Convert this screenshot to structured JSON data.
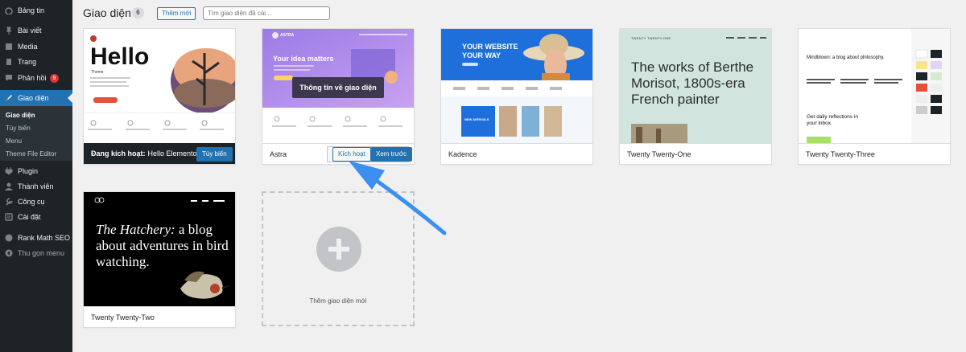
{
  "sidebar": {
    "items": [
      {
        "label": "Bảng tin",
        "icon": "dashboard-icon"
      },
      {
        "label": "Bài viết",
        "icon": "pin-icon"
      },
      {
        "label": "Media",
        "icon": "media-icon"
      },
      {
        "label": "Trang",
        "icon": "page-icon"
      },
      {
        "label": "Phản hồi",
        "icon": "comment-icon",
        "badge": "9"
      },
      {
        "label": "Giao diện",
        "icon": "brush-icon"
      },
      {
        "label": "Plugin",
        "icon": "plugin-icon"
      },
      {
        "label": "Thành viên",
        "icon": "users-icon"
      },
      {
        "label": "Công cụ",
        "icon": "wrench-icon"
      },
      {
        "label": "Cài đặt",
        "icon": "settings-icon"
      },
      {
        "label": "Rank Math SEO",
        "icon": "rankmath-icon"
      },
      {
        "label": "Thu gọn menu",
        "icon": "collapse-icon"
      }
    ],
    "submenu": [
      "Giao diện",
      "Tùy biến",
      "Menu",
      "Theme File Editor"
    ]
  },
  "header": {
    "title": "Giao diện",
    "count": "6",
    "add_new": "Thêm mới",
    "search_placeholder": "Tìm giao diện đã cài..."
  },
  "themes": {
    "hello": {
      "active_prefix": "Đang kích hoạt:",
      "name": "Hello Elementor",
      "customize": "Tùy biến",
      "shot_title": "Hello",
      "shot_sub": "Theme"
    },
    "astra": {
      "name": "Astra",
      "activate": "Kích hoạt",
      "preview": "Xem trước",
      "overlay": "Thông tin về giao diện",
      "shot_logo": "ASTRA",
      "shot_headline": "Your idea matters"
    },
    "kadence": {
      "name": "Kadence",
      "shot_headline_1": "YOUR WEBSITE",
      "shot_headline_2": "YOUR WAY",
      "shot_badge": "NEW ARRIVALS"
    },
    "twentyone": {
      "name": "Twenty Twenty-One",
      "shot_header": "TWENTY TWENTY-ONE",
      "shot_text": "The works of Berthe Morisot, 1800s-era French painter"
    },
    "twentythree": {
      "name": "Twenty Twenty-Three",
      "shot_headline": "Mindblown: a blog about philosophy.",
      "shot_sub": "Get daily reflections in your inbox."
    },
    "twentytwo": {
      "name": "Twenty Twenty-Two",
      "shot_italic": "The Hatchery:",
      "shot_text": " a blog about adventures in bird watching."
    }
  },
  "add_theme": {
    "label": "Thêm giao diện mới"
  },
  "colors": {
    "sidebar_bg": "#1d2327",
    "accent": "#2271b1",
    "arrow": "#3b8ff0"
  }
}
